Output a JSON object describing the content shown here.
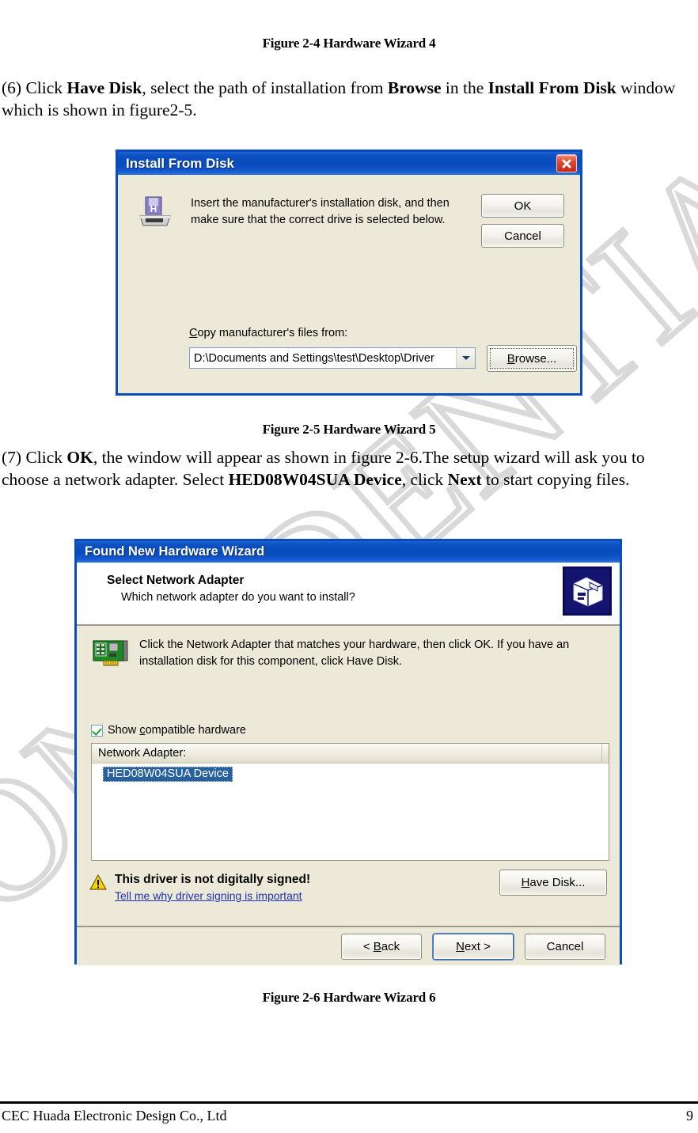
{
  "watermark": {
    "text": "CONFIDENTIAL"
  },
  "figure_caption_top": "Figure 2-4 Hardware Wizard 4",
  "paragraph6": {
    "p1": "(6) Click ",
    "b1": "Have Disk",
    "p2": ", select the path of installation from ",
    "b2": "Browse",
    "p3": " in the ",
    "b3": "Install From Disk",
    "p4": " window which is shown in figure2-5."
  },
  "install_from_disk": {
    "title": "Install From Disk",
    "close_label": "Close",
    "message_line1": "Insert the manufacturer's installation disk, and then",
    "message_line2": "make sure that the correct drive is selected below.",
    "ok_label": "OK",
    "cancel_label": "Cancel",
    "copy_label_prefix": "C",
    "copy_label_rest": "opy manufacturer's files from:",
    "path_value": "D:\\Documents and Settings\\test\\Desktop\\Driver",
    "browse_prefix": "B",
    "browse_rest": "rowse...",
    "disk_icon": "floppy-disk-icon",
    "dropdown_icon": "chevron-down-icon"
  },
  "figure_caption_mid": "Figure 2-5 Hardware Wizard 5",
  "paragraph7": {
    "p1": "(7) Click ",
    "b1": "OK",
    "p2": ", the window will appear as shown in figure 2-6.The setup wizard will ask you to choose a network adapter. Select ",
    "b2": "HED08W04SUA Device",
    "p3": ", click ",
    "b3": "Next",
    "p4": " to start copying files."
  },
  "hardware_wizard": {
    "title": "Found New Hardware Wizard",
    "header_title": "Select Network Adapter",
    "header_subtitle": "Which network adapter do you want to install?",
    "header_icon": "network-hardware-icon",
    "nic_icon": "network-card-icon",
    "instruction_line1": "Click the Network Adapter that matches your hardware, then click OK. If you have an",
    "instruction_line2": "installation disk for this component, click Have Disk.",
    "checkbox_checked": true,
    "checkbox_prefix": "Show ",
    "checkbox_accel": "c",
    "checkbox_rest": "ompatible hardware",
    "list_header": "Network Adapter:",
    "list_items": [
      "HED08W04SUA Device"
    ],
    "warning_icon": "warning-triangle-icon",
    "warning_title": "This driver is not digitally signed!",
    "warning_link": "Tell me why driver signing is important",
    "have_disk_prefix": "H",
    "have_disk_rest": "ave Disk...",
    "back_prefix": "< ",
    "back_accel": "B",
    "back_rest": "ack",
    "next_accel": "N",
    "next_rest": "ext >",
    "cancel_label": "Cancel"
  },
  "figure_caption_bottom": "Figure 2-6 Hardware Wizard 6",
  "footer": {
    "company": "CEC Huada Electronic Design Co., Ltd",
    "page_number": "9"
  }
}
